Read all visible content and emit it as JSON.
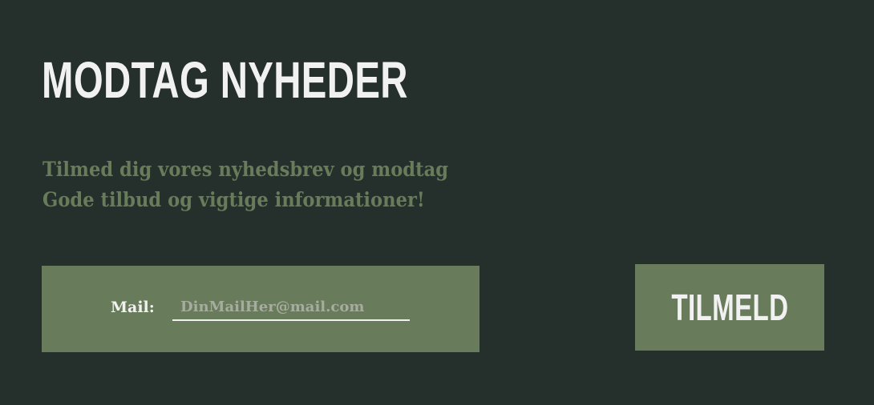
{
  "colors": {
    "background": "#252f2b",
    "accent_green": "#687b5a",
    "text_light": "#f1f1f1",
    "placeholder": "#a6ad9f"
  },
  "newsletter": {
    "title": "MODTAG NYHEDER",
    "subtitle_line1": "Tilmed dig vores nyhedsbrev og modtag",
    "subtitle_line2": "Gode tilbud og vigtige informationer!",
    "mail_label": "Mail:",
    "mail_value": "",
    "mail_placeholder": "DinMailHer@mail.com",
    "submit_label": "TILMELD"
  }
}
